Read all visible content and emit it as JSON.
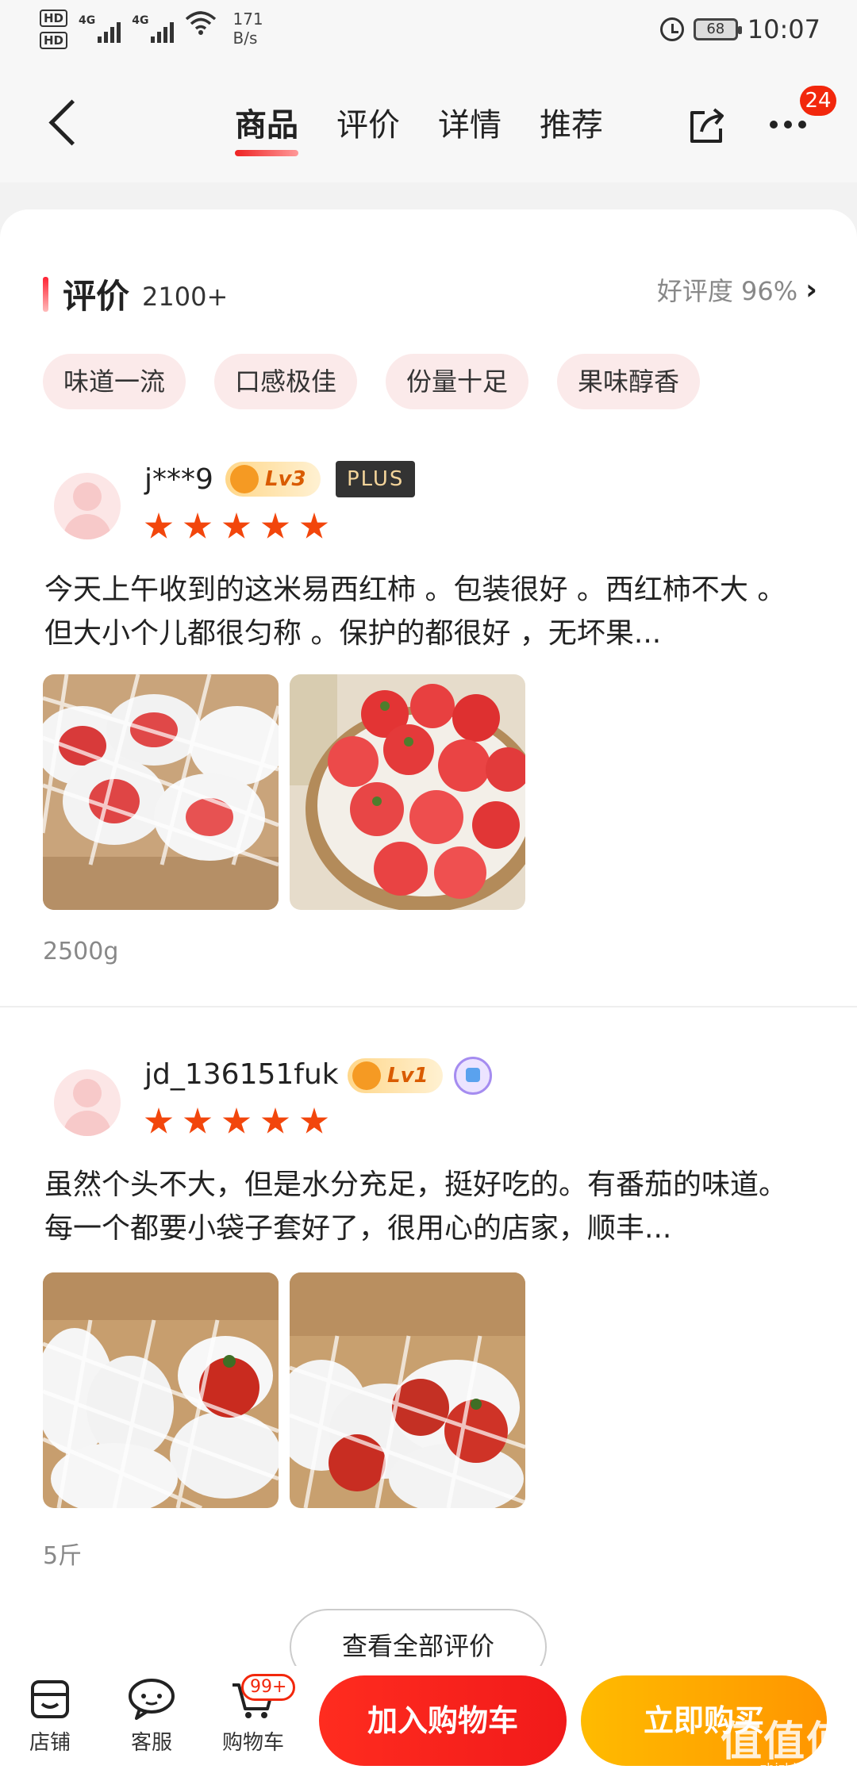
{
  "status": {
    "hd1": "HD",
    "hd2": "HD",
    "net1": "4G",
    "net2": "4G",
    "speed_value": "171",
    "speed_unit": "B/s",
    "battery": "68",
    "time": "10:07"
  },
  "nav": {
    "tabs": [
      {
        "label": "商品",
        "active": true
      },
      {
        "label": "评价"
      },
      {
        "label": "详情"
      },
      {
        "label": "推荐"
      }
    ],
    "more_badge": "24"
  },
  "reviews_section": {
    "title": "评价",
    "count": "2100+",
    "rating": "好评度 96%",
    "tags": [
      "味道一流",
      "口感极佳",
      "份量十足",
      "果味醇香"
    ],
    "see_all": "查看全部评价"
  },
  "reviews": [
    {
      "username": "j***9",
      "level": "Lv3",
      "plus": "PLUS",
      "stars": 5,
      "text": "今天上午收到的这米易西红柿 。包装很好 。西红柿不大 。但大小个儿都很匀称 。保护的都很好 ，无坏果...",
      "spec": "2500g"
    },
    {
      "username": "jd_136151fuk",
      "level": "Lv1",
      "stars": 5,
      "text": "虽然个头不大，但是水分充足，挺好吃的。有番茄的味道。每一个都要小袋子套好了，很用心的店家，顺丰...",
      "spec": "5斤"
    }
  ],
  "bottom_bar": {
    "store": "店铺",
    "service": "客服",
    "cart": "购物车",
    "cart_badge": "99+",
    "add_to_cart": "加入购物车",
    "buy_now": "立即购买"
  },
  "watermark": {
    "main": "值值值",
    "sub": "zhizhizhi.com"
  },
  "colors": {
    "accent_red": "#f2270c",
    "buy_orange": "#ff9f00",
    "star": "#f2460c"
  }
}
